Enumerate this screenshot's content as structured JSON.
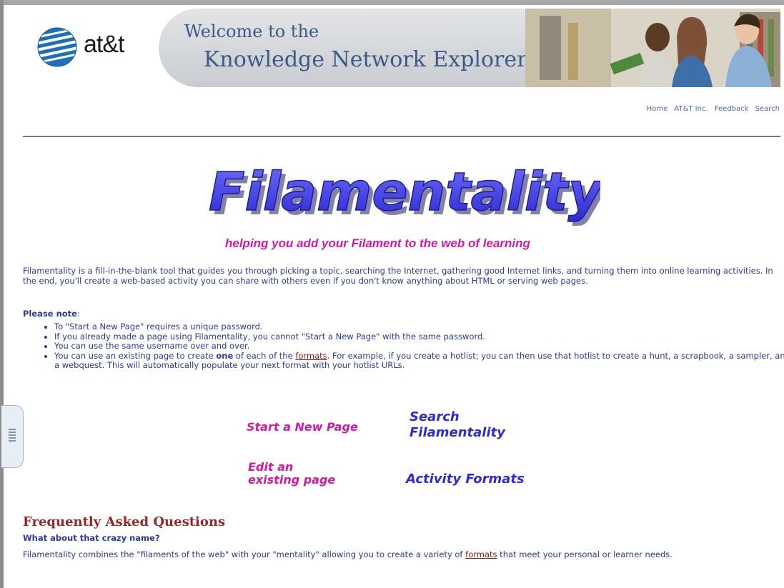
{
  "header": {
    "logo_text": "at&t",
    "welcome_line": "Welcome to the",
    "title_line": "Knowledge Network Explorer"
  },
  "nav": [
    "Home",
    "AT&T Inc.",
    "Feedback",
    "Search"
  ],
  "brand": {
    "wordmark": "Filamentality",
    "tagline": "helping you add your Filament to the web of learning"
  },
  "intro": "Filamentality is a fill-in-the-blank tool that guides you through picking a topic, searching the Internet, gathering good Internet links, and turning them into online learning activities. In the end, you'll create a web-based activity you can share with others even if you don't know anything about HTML or serving web pages.",
  "note": {
    "label": "Please note",
    "colon": ":",
    "bullets": [
      "To \"Start a New Page\" requires a unique password.",
      "If you already made a page using Filamentality, you cannot \"Start a New Page\" with the same password.",
      "You can use the same username over and over."
    ],
    "last_bullet": {
      "before": "You can use an existing page to create ",
      "bold": "one",
      "middle": " of each of the ",
      "link": "formats",
      "after": ". For example, if you create a hotlist; you can then use that hotlist to create a hunt, a scrapbook, a sampler, and a webquest. This will automatically populate your next format with your hotlist URLs."
    }
  },
  "actions": {
    "start_new": "Start a New Page",
    "search_line1": "Search",
    "search_line2": "Filamentality",
    "edit_line1": "Edit an",
    "edit_line2": "existing page",
    "activity_formats": "Activity Formats"
  },
  "faq": {
    "title": "Frequently Asked Questions",
    "question": "What about that crazy name?",
    "answer_before": "Filamentality combines the \"filaments of the web\" with your \"mentality\" allowing you to create a variety of ",
    "answer_link": "formats",
    "answer_after": " that meet your personal or learner needs."
  },
  "colors": {
    "accent_pink": "#d219a6",
    "accent_blue": "#2b2bd6",
    "text_blue": "#2a3a9a",
    "faq_red": "#9b2424"
  }
}
